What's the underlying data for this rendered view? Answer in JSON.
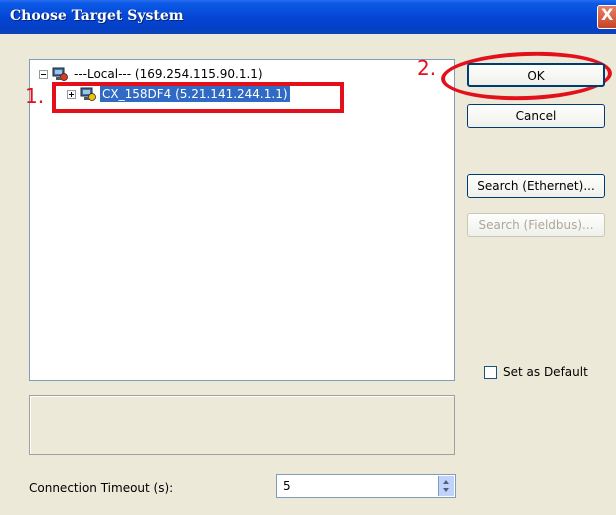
{
  "window": {
    "title": "Choose Target System",
    "close_glyph": "X"
  },
  "tree": {
    "items": [
      {
        "label": "---Local---   (169.254.115.90.1.1)",
        "expander": "minus",
        "icon": "network-computer-icon"
      },
      {
        "label": "CX_158DF4   (5.21.141.244.1.1)",
        "expander": "plus",
        "icon": "network-computer-icon",
        "selected": true
      }
    ]
  },
  "annotations": {
    "step1": "1.",
    "step2": "2."
  },
  "buttons": {
    "ok": "OK",
    "cancel": "Cancel",
    "search_ethernet": "Search (Ethernet)...",
    "search_fieldbus": "Search (Fieldbus)..."
  },
  "set_as_default": {
    "label": "Set as Default",
    "checked": false
  },
  "timeout": {
    "label": "Connection Timeout (s):",
    "value": "5"
  },
  "colors": {
    "selection": "#316ac5",
    "annotation_red": "#e3101c",
    "titlebar": "#0546d6"
  }
}
